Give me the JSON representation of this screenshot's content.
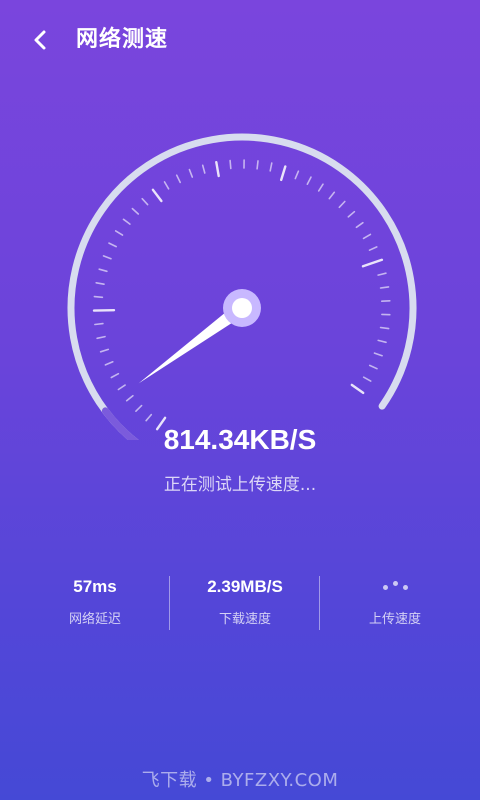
{
  "header": {
    "title": "网络测速",
    "back_icon": "chevron-left-icon"
  },
  "gauge": {
    "speed_text": "814.34KB/S",
    "status_text": "正在测试上传速度...",
    "needle_fraction": 0.07
  },
  "stats": [
    {
      "value": "57ms",
      "label": "网络延迟"
    },
    {
      "value": "2.39MB/S",
      "label": "下载速度"
    },
    {
      "value": "",
      "label": "上传速度"
    }
  ],
  "watermark": "飞下载 • BYFZXY.COM",
  "colors": {
    "bg_top": "#7a45dd",
    "bg_bottom": "#4549d6",
    "progress": "#7b5bdc",
    "hub": "#c8b8ff"
  }
}
